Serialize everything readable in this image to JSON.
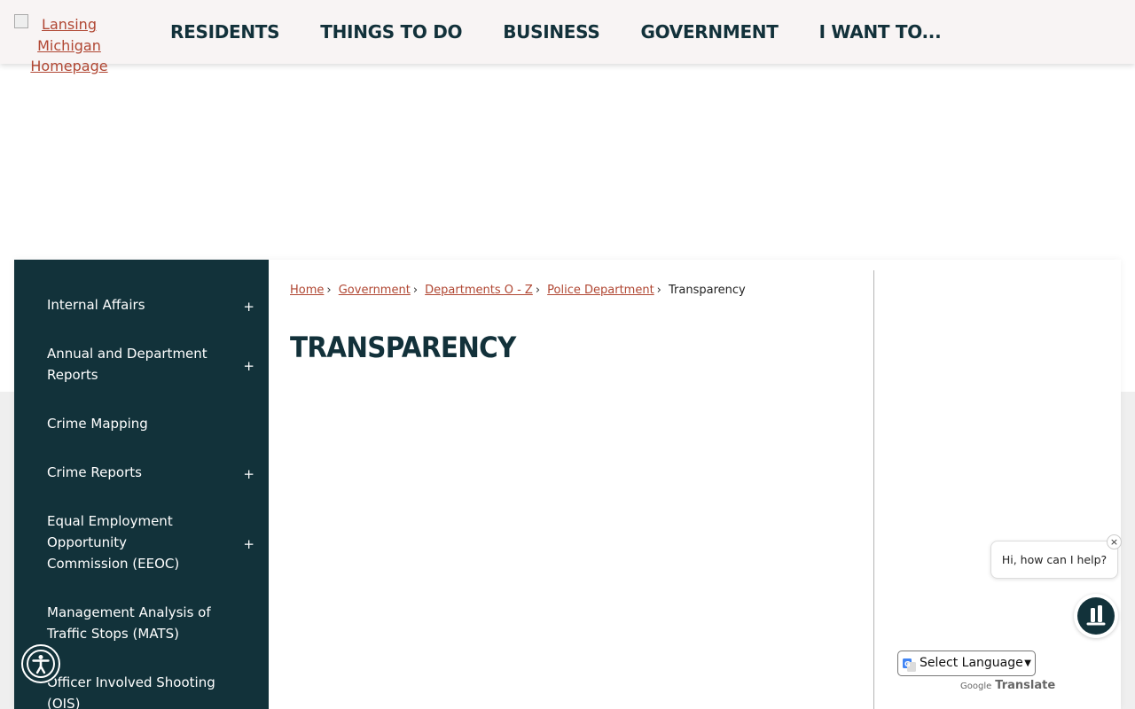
{
  "logo": {
    "alt_text": "Lansing Michigan Homepage"
  },
  "nav": [
    {
      "label": "RESIDENTS"
    },
    {
      "label": "THINGS TO DO"
    },
    {
      "label": "BUSINESS"
    },
    {
      "label": "GOVERNMENT"
    },
    {
      "label": "I WANT TO..."
    }
  ],
  "sidebar": {
    "items": [
      {
        "label": "Internal Affairs",
        "toggle": "+"
      },
      {
        "label": "Annual and Department Reports",
        "toggle": "+"
      },
      {
        "label": "Crime Mapping",
        "toggle": ""
      },
      {
        "label": "Crime Reports",
        "toggle": "+"
      },
      {
        "label": "Equal Employment Opportunity Commission (EEOC)",
        "toggle": "+"
      },
      {
        "label": "Management Analysis of Traffic Stops (MATS)",
        "toggle": ""
      },
      {
        "label": "Officer Involved Shooting (OIS)",
        "toggle": ""
      }
    ]
  },
  "breadcrumb": {
    "items": [
      "Home",
      " Government",
      " Departments O - Z",
      " Police Department"
    ],
    "separator": "›",
    "current": "Transparency"
  },
  "page": {
    "title": "TRANSPARENCY"
  },
  "chat": {
    "greeting": "Hi, how can I help?",
    "close_symbol": "×"
  },
  "translate": {
    "select_label": "Select Language",
    "powered_by": "Google",
    "translate_label": "Translate"
  },
  "colors": {
    "brand_dark": "#12323a",
    "link": "#b04632",
    "header_bg": "#f8f4f4"
  }
}
